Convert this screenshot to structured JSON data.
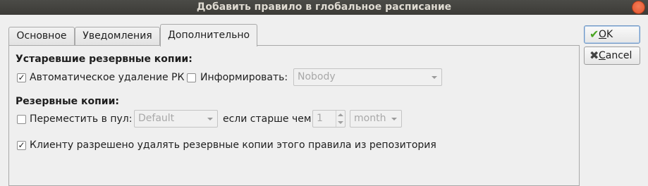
{
  "window": {
    "title": "Добавить правило в глобальное расписание"
  },
  "tabs": [
    {
      "label": "Основное"
    },
    {
      "label": "Уведомления"
    },
    {
      "label": "Дополнительно"
    }
  ],
  "outdated_section": {
    "heading": "Устаревшие резервные копии:",
    "auto_delete": {
      "label": "Автоматическое удаление РК",
      "checked": true
    },
    "notify": {
      "label": "Информировать:",
      "checked": false
    },
    "notify_combo": {
      "value": "Nobody"
    }
  },
  "backups_section": {
    "heading": "Резервные копии:",
    "move_to_pool": {
      "label": "Переместить в пул:",
      "checked": false
    },
    "pool_combo": {
      "value": "Default"
    },
    "older_than_label": "если старше чем",
    "age_value": "1",
    "age_unit_combo": {
      "value": "month"
    }
  },
  "client_delete": {
    "label": "Клиенту разрешено удалять резервные копии этого правила из репозитория",
    "checked": true
  },
  "buttons": {
    "ok": {
      "mnemonic": "O",
      "rest": "K"
    },
    "cancel": {
      "mnemonic": "C",
      "rest": "ancel"
    }
  },
  "icons": {
    "check_mark": "✓",
    "ok_icon": "✔",
    "cancel_icon": "✖"
  }
}
